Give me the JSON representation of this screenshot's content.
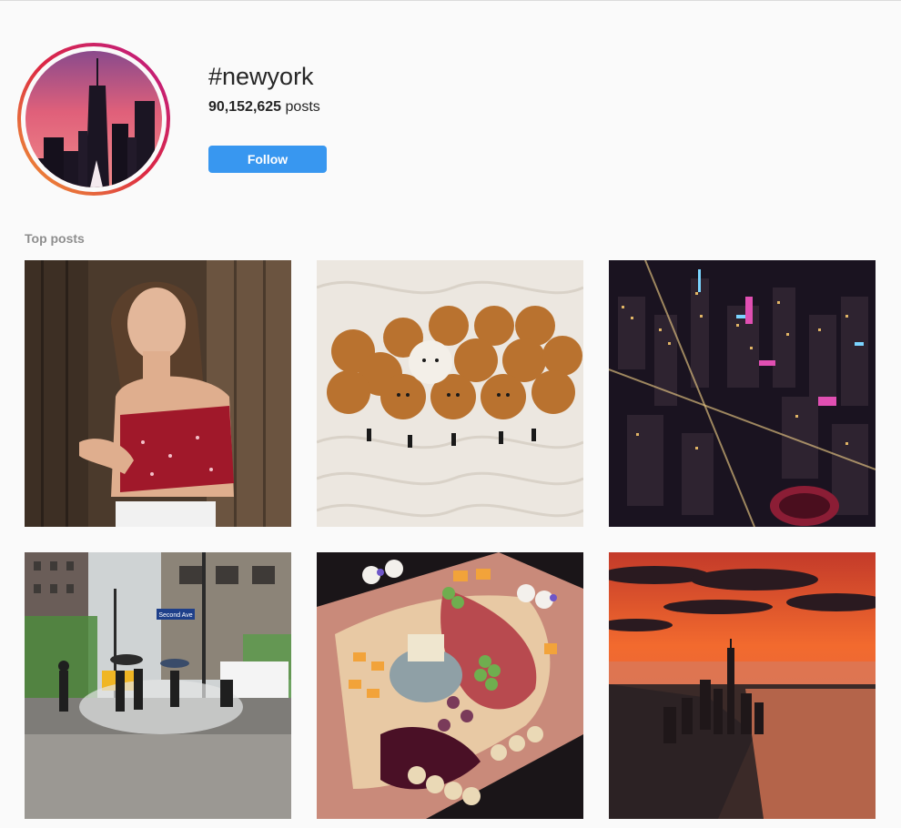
{
  "header": {
    "hashtag": "#newyork",
    "post_count_number": "90,152,625",
    "post_count_suffix": " posts",
    "follow_label": "Follow"
  },
  "top_posts": {
    "label": "Top posts",
    "items": [
      {
        "subject": "portrait-of-woman-in-red-top"
      },
      {
        "subject": "pomeranian-puppies-on-white-knit"
      },
      {
        "subject": "aerial-night-manhattan"
      },
      {
        "subject": "rainy-street-second-ave"
      },
      {
        "subject": "charcuterie-board"
      },
      {
        "subject": "sunset-lower-manhattan-aerial"
      }
    ],
    "street_sign_text": "Second Ave"
  },
  "colors": {
    "follow_button": "#3897f0",
    "background": "#fafafa",
    "muted_text": "#8e8e8e",
    "ring_gradient": [
      "#f09433",
      "#dc2743",
      "#bc1888"
    ]
  }
}
